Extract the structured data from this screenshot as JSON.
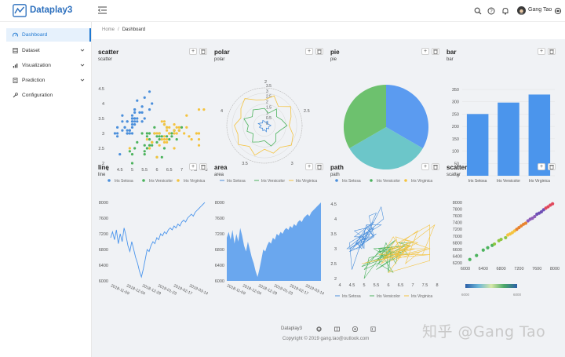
{
  "app": {
    "name": "Dataplay3"
  },
  "header": {
    "username": "Gang Tao",
    "tools": [
      "search-icon",
      "help-icon",
      "bell-icon",
      "avatar",
      "settings-icon"
    ]
  },
  "sidebar": {
    "items": [
      {
        "label": "Dashboard",
        "icon": "dashboard-icon",
        "active": true,
        "expandable": false
      },
      {
        "label": "Dataset",
        "icon": "dataset-icon",
        "active": false,
        "expandable": true
      },
      {
        "label": "Visualization",
        "icon": "visualization-icon",
        "active": false,
        "expandable": true
      },
      {
        "label": "Prediction",
        "icon": "prediction-icon",
        "active": false,
        "expandable": true
      },
      {
        "label": "Configuration",
        "icon": "configuration-icon",
        "active": false,
        "expandable": false
      }
    ]
  },
  "breadcrumb": {
    "items": [
      "Home",
      "Dashboard"
    ]
  },
  "panel_buttons": {
    "add": "+",
    "delete": "trash-icon"
  },
  "colors": {
    "setosa": "#4b8fdb",
    "versicolor": "#4cb35d",
    "virginica": "#f4c33f",
    "accent": "#1f78d1",
    "bar": "#4b95ec",
    "area": "#6aa7ee"
  },
  "panels": [
    {
      "title": "scatter",
      "subtitle": "scatter"
    },
    {
      "title": "polar",
      "subtitle": "polar"
    },
    {
      "title": "pie",
      "subtitle": "pie"
    },
    {
      "title": "bar",
      "subtitle": "bar"
    },
    {
      "title": "line",
      "subtitle": "line"
    },
    {
      "title": "area",
      "subtitle": "area"
    },
    {
      "title": "path",
      "subtitle": "path"
    },
    {
      "title": "scatter",
      "subtitle": "scatter"
    }
  ],
  "legend": {
    "species": [
      "Iris Setosa",
      "Iris Versicolor",
      "Iris Virginica"
    ]
  },
  "chart_data": [
    {
      "type": "scatter",
      "title": "scatter",
      "xlim": [
        4,
        8
      ],
      "ylim": [
        2,
        4.5
      ],
      "x_ticks": [
        "4",
        "4.5",
        "5",
        "5.5",
        "6",
        "6.5",
        "7",
        "7.5",
        "8"
      ],
      "y_ticks": [
        "2",
        "2.5",
        "3",
        "3.5",
        "4",
        "4.5"
      ],
      "series": [
        {
          "name": "Iris Setosa",
          "points": [
            [
              5.1,
              3.5
            ],
            [
              4.9,
              3.0
            ],
            [
              4.7,
              3.2
            ],
            [
              4.6,
              3.1
            ],
            [
              5.0,
              3.6
            ],
            [
              5.4,
              3.9
            ],
            [
              4.6,
              3.4
            ],
            [
              5.0,
              3.4
            ],
            [
              4.4,
              2.9
            ],
            [
              4.9,
              3.1
            ],
            [
              5.4,
              3.7
            ],
            [
              4.8,
              3.4
            ],
            [
              4.8,
              3.0
            ],
            [
              4.3,
              3.0
            ],
            [
              5.8,
              4.0
            ],
            [
              5.7,
              4.4
            ],
            [
              5.4,
              3.9
            ],
            [
              5.1,
              3.5
            ],
            [
              5.7,
              3.8
            ],
            [
              5.1,
              3.8
            ],
            [
              5.4,
              3.4
            ],
            [
              5.1,
              3.7
            ],
            [
              4.6,
              3.6
            ],
            [
              5.1,
              3.3
            ],
            [
              4.8,
              3.4
            ],
            [
              5.0,
              3.0
            ],
            [
              5.0,
              3.4
            ],
            [
              5.2,
              3.5
            ],
            [
              5.2,
              3.4
            ],
            [
              4.7,
              3.2
            ],
            [
              4.8,
              3.1
            ],
            [
              5.4,
              3.4
            ],
            [
              5.2,
              4.1
            ],
            [
              5.5,
              4.2
            ],
            [
              4.9,
              3.1
            ],
            [
              5.0,
              3.2
            ],
            [
              5.5,
              3.5
            ],
            [
              4.4,
              3.0
            ],
            [
              5.1,
              3.4
            ],
            [
              5.0,
              3.5
            ],
            [
              4.5,
              2.3
            ],
            [
              4.4,
              3.2
            ],
            [
              5.0,
              3.5
            ],
            [
              5.1,
              3.8
            ],
            [
              4.8,
              3.0
            ],
            [
              5.3,
              3.7
            ],
            [
              5.0,
              3.3
            ]
          ]
        },
        {
          "name": "Iris Versicolor",
          "points": [
            [
              7.0,
              3.2
            ],
            [
              6.4,
              3.2
            ],
            [
              6.9,
              3.1
            ],
            [
              5.5,
              2.3
            ],
            [
              6.5,
              2.8
            ],
            [
              5.7,
              2.8
            ],
            [
              6.3,
              3.3
            ],
            [
              4.9,
              2.4
            ],
            [
              6.6,
              2.9
            ],
            [
              5.2,
              2.7
            ],
            [
              5.0,
              2.0
            ],
            [
              5.9,
              3.0
            ],
            [
              6.0,
              2.2
            ],
            [
              6.1,
              2.9
            ],
            [
              5.6,
              2.9
            ],
            [
              6.7,
              3.1
            ],
            [
              5.6,
              3.0
            ],
            [
              5.8,
              2.7
            ],
            [
              6.2,
              2.2
            ],
            [
              5.6,
              2.5
            ],
            [
              5.9,
              3.2
            ],
            [
              6.1,
              2.8
            ],
            [
              6.3,
              2.5
            ],
            [
              6.4,
              2.9
            ],
            [
              6.6,
              3.0
            ],
            [
              6.8,
              2.8
            ],
            [
              6.0,
              2.9
            ],
            [
              5.7,
              2.6
            ],
            [
              5.5,
              2.4
            ],
            [
              5.8,
              2.7
            ],
            [
              6.0,
              2.7
            ],
            [
              5.4,
              3.0
            ],
            [
              6.7,
              3.1
            ],
            [
              5.5,
              2.6
            ],
            [
              6.1,
              3.0
            ],
            [
              5.8,
              2.6
            ],
            [
              5.0,
              2.3
            ],
            [
              5.7,
              3.0
            ],
            [
              6.2,
              2.9
            ],
            [
              5.1,
              2.5
            ]
          ]
        },
        {
          "name": "Iris Virginica",
          "points": [
            [
              6.3,
              3.3
            ],
            [
              5.8,
              2.7
            ],
            [
              7.1,
              3.0
            ],
            [
              6.3,
              2.9
            ],
            [
              6.5,
              3.0
            ],
            [
              7.6,
              3.0
            ],
            [
              4.9,
              2.5
            ],
            [
              7.3,
              2.9
            ],
            [
              6.7,
              2.5
            ],
            [
              7.2,
              3.6
            ],
            [
              6.5,
              3.2
            ],
            [
              6.4,
              2.7
            ],
            [
              6.8,
              3.0
            ],
            [
              5.7,
              2.5
            ],
            [
              6.4,
              3.2
            ],
            [
              7.7,
              3.8
            ],
            [
              7.7,
              2.6
            ],
            [
              6.0,
              2.2
            ],
            [
              6.9,
              3.2
            ],
            [
              5.6,
              2.8
            ],
            [
              7.7,
              2.8
            ],
            [
              6.3,
              2.7
            ],
            [
              6.7,
              3.3
            ],
            [
              7.2,
              3.2
            ],
            [
              6.2,
              2.8
            ],
            [
              6.1,
              3.0
            ],
            [
              6.4,
              2.8
            ],
            [
              7.4,
              2.8
            ],
            [
              7.9,
              3.8
            ],
            [
              6.3,
              2.8
            ],
            [
              6.1,
              2.6
            ],
            [
              7.7,
              3.0
            ],
            [
              6.3,
              3.4
            ],
            [
              6.4,
              3.1
            ],
            [
              6.0,
              3.0
            ],
            [
              6.9,
              3.1
            ],
            [
              6.7,
              3.1
            ],
            [
              6.9,
              3.1
            ],
            [
              5.8,
              2.7
            ],
            [
              6.8,
              3.2
            ],
            [
              6.7,
              3.0
            ],
            [
              6.5,
              3.0
            ],
            [
              6.2,
              3.4
            ],
            [
              5.9,
              3.0
            ]
          ]
        }
      ],
      "legend_placement": "bottom"
    },
    {
      "type": "polar",
      "title": "polar",
      "radial_ticks": [
        "0",
        "0.5",
        "1",
        "1.5",
        "2",
        "2.5",
        "3",
        "3.5"
      ],
      "angle_labels": [
        "2",
        "2.5",
        "3",
        "3.5",
        "4"
      ],
      "series": [
        {
          "name": "Iris Setosa",
          "radius": [
            0.4,
            0.3,
            0.5,
            0.3,
            0.4,
            0.6,
            0.4,
            0.5,
            0.3,
            0.6,
            0.4,
            0.5,
            0.3,
            0.4,
            0.5,
            0.3,
            0.6,
            0.4,
            0.3,
            0.5
          ]
        },
        {
          "name": "Iris Versicolor",
          "radius": [
            1.6,
            1.2,
            1.9,
            1.4,
            1.7,
            2.1,
            1.5,
            1.3,
            1.8,
            2.0,
            1.4,
            1.6,
            1.9,
            1.3,
            1.7,
            1.5,
            2.0,
            1.4,
            1.8,
            1.6
          ]
        },
        {
          "name": "Iris Virginica",
          "radius": [
            2.4,
            2.9,
            2.2,
            3.0,
            2.6,
            2.3,
            2.8,
            3.1,
            2.5,
            2.7,
            2.2,
            2.9,
            2.4,
            3.0,
            2.6,
            2.8,
            2.3,
            2.7,
            3.1,
            2.5
          ]
        }
      ],
      "legend_placement": "bottom"
    },
    {
      "type": "pie",
      "title": "pie",
      "slices": [
        {
          "name": "Iris Setosa",
          "value": 50
        },
        {
          "name": "Iris Versicolor",
          "value": 50
        },
        {
          "name": "Iris Virginica",
          "value": 50
        }
      ],
      "legend_placement": "bottom"
    },
    {
      "type": "bar",
      "title": "bar",
      "categories": [
        "Iris Setosa",
        "Iris Versicolor",
        "Iris Virginica"
      ],
      "values": [
        250.3,
        296.8,
        329.4
      ],
      "ylim": [
        0,
        350
      ],
      "y_ticks": [
        "0",
        "50",
        "100",
        "150",
        "200",
        "250",
        "300",
        "350"
      ]
    },
    {
      "type": "line",
      "title": "line",
      "ylim": [
        6000,
        8000
      ],
      "y_ticks": [
        "6000",
        "6400",
        "6800",
        "7200",
        "7600",
        "8000"
      ],
      "x_ticks": [
        "2018-11-09",
        "2018-12-04",
        "2018-12-29",
        "2019-01-23",
        "2019-02-17",
        "2019-03-14"
      ],
      "values": [
        7100,
        7250,
        7050,
        7300,
        6950,
        7200,
        7000,
        7350,
        7150,
        6900,
        6750,
        7000,
        6800,
        6600,
        6450,
        6250,
        6100,
        6300,
        6550,
        6800,
        6750,
        6900,
        7000,
        6950,
        7100,
        7050,
        7200,
        7150,
        7250,
        7200,
        7300,
        7350,
        7300,
        7400,
        7350,
        7450,
        7400,
        7500,
        7550,
        7500,
        7600,
        7650,
        7700,
        7650,
        7750,
        7800,
        7850,
        7900,
        7950,
        8000
      ]
    },
    {
      "type": "area",
      "title": "area",
      "ylim": [
        6000,
        8000
      ],
      "y_ticks": [
        "6000",
        "6400",
        "6800",
        "7200",
        "7600",
        "8000"
      ],
      "x_ticks": [
        "2018-11-09",
        "2018-12-04",
        "2018-12-29",
        "2019-01-23",
        "2019-02-17",
        "2019-03-14"
      ],
      "values": [
        7100,
        7250,
        7050,
        7300,
        6950,
        7200,
        7000,
        7350,
        7150,
        6900,
        6750,
        7000,
        6800,
        6600,
        6450,
        6250,
        6100,
        6300,
        6550,
        6800,
        6750,
        6900,
        7000,
        6950,
        7100,
        7050,
        7200,
        7150,
        7250,
        7200,
        7300,
        7350,
        7300,
        7400,
        7350,
        7450,
        7400,
        7500,
        7550,
        7500,
        7600,
        7650,
        7700,
        7650,
        7750,
        7800,
        7850,
        7900,
        7950,
        8000
      ]
    },
    {
      "type": "line",
      "title": "path",
      "xlim": [
        4,
        8
      ],
      "ylim": [
        2,
        4.5
      ],
      "x_ticks": [
        "4",
        "4.5",
        "5",
        "5.5",
        "6",
        "6.5",
        "7",
        "7.5",
        "8"
      ],
      "y_ticks": [
        "2",
        "2.5",
        "3",
        "3.5",
        "4",
        "4.5"
      ],
      "series_source": "same iris points as scatter, joined in sample order",
      "legend_placement": "bottom"
    },
    {
      "type": "scatter",
      "title": "scatter",
      "xlim": [
        6000,
        8000
      ],
      "ylim": [
        6200,
        8000
      ],
      "x_ticks": [
        "6000",
        "6400",
        "6800",
        "7200",
        "7600",
        "8000"
      ],
      "y_ticks": [
        "6200",
        "6400",
        "6600",
        "6800",
        "7000",
        "7200",
        "7400",
        "7600",
        "7800",
        "8000"
      ],
      "points": [
        [
          6100,
          6300
        ],
        [
          6250,
          6420
        ],
        [
          6400,
          6580
        ],
        [
          6500,
          6650
        ],
        [
          6600,
          6720
        ],
        [
          6650,
          6760
        ],
        [
          6750,
          6860
        ],
        [
          6800,
          6900
        ],
        [
          6900,
          6950
        ],
        [
          6950,
          7030
        ],
        [
          7000,
          7060
        ],
        [
          7050,
          7100
        ],
        [
          7100,
          7150
        ],
        [
          7150,
          7200
        ],
        [
          7200,
          7250
        ],
        [
          7250,
          7300
        ],
        [
          7300,
          7350
        ],
        [
          7350,
          7380
        ],
        [
          7400,
          7450
        ],
        [
          7450,
          7500
        ],
        [
          7500,
          7530
        ],
        [
          7550,
          7580
        ],
        [
          7600,
          7650
        ],
        [
          7650,
          7680
        ],
        [
          7700,
          7720
        ],
        [
          7750,
          7780
        ],
        [
          7800,
          7830
        ],
        [
          7850,
          7870
        ],
        [
          7900,
          7920
        ],
        [
          7950,
          7960
        ]
      ],
      "colorbar": {
        "min": "6000",
        "max": "6000"
      }
    }
  ],
  "footer": {
    "name": "Dataplay3",
    "copyright": "Copyright © 2019 gang.tao@outlook.com",
    "icons": [
      "github-icon",
      "book-icon",
      "gitee-icon",
      "share-icon"
    ]
  },
  "watermark": "知乎 @Gang Tao"
}
